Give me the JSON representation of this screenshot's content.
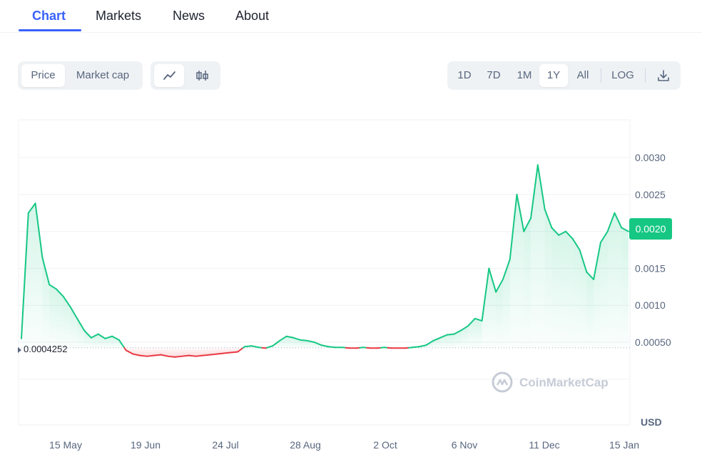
{
  "tabs": [
    {
      "label": "Chart",
      "active": true
    },
    {
      "label": "Markets",
      "active": false
    },
    {
      "label": "News",
      "active": false
    },
    {
      "label": "About",
      "active": false
    }
  ],
  "toolbar": {
    "metric": {
      "options": [
        "Price",
        "Market cap"
      ],
      "selected": "Price"
    },
    "chart_type": {
      "options": [
        "line-chart-icon",
        "candlestick-icon"
      ],
      "selected": "line-chart-icon"
    },
    "ranges": {
      "options": [
        "1D",
        "7D",
        "1M",
        "1Y",
        "All"
      ],
      "selected": "1Y"
    },
    "log_label": "LOG",
    "download_icon": "download-icon"
  },
  "chart": {
    "current_price": "0.0020",
    "reference_price": "0.0004252",
    "currency": "USD",
    "watermark": "CoinMarketCap",
    "colors": {
      "up": "#16c784",
      "down": "#ea3943",
      "grid": "#eff2f5",
      "axis_text": "#58667e"
    }
  },
  "chart_data": {
    "type": "line",
    "x_tick_labels": [
      "15 May",
      "19 Jun",
      "24 Jul",
      "28 Aug",
      "2 Oct",
      "6 Nov",
      "11 Dec",
      "15 Jan"
    ],
    "y_tick_labels": [
      "0.00050",
      "0.0010",
      "0.0015",
      "0.0020",
      "0.0025",
      "0.0030"
    ],
    "y_ticks": [
      0.0005,
      0.001,
      0.0015,
      0.002,
      0.0025,
      0.003
    ],
    "ylim": [
      0.0001,
      0.0031
    ],
    "baseline": 0.0004252,
    "series": [
      {
        "values": [
          0.00055,
          0.00225,
          0.00238,
          0.00165,
          0.00128,
          0.00122,
          0.00112,
          0.00098,
          0.00082,
          0.00066,
          0.00056,
          0.00061,
          0.00055,
          0.00058,
          0.00053,
          0.00039,
          0.00034,
          0.00032,
          0.00031,
          0.00032,
          0.00033,
          0.00031,
          0.0003,
          0.00031,
          0.00032,
          0.00031,
          0.00032,
          0.00033,
          0.00034,
          0.00035,
          0.00036,
          0.00037,
          0.00044,
          0.00045,
          0.00043,
          0.00042,
          0.00045,
          0.00052,
          0.00058,
          0.00056,
          0.00053,
          0.00052,
          0.0005,
          0.00046,
          0.00044,
          0.00043,
          0.00043,
          0.00042,
          0.00042,
          0.00043,
          0.00042,
          0.00042,
          0.00043,
          0.00042,
          0.00042,
          0.00042,
          0.00043,
          0.00044,
          0.00046,
          0.00052,
          0.00056,
          0.0006,
          0.00061,
          0.00066,
          0.00072,
          0.00082,
          0.00079,
          0.0015,
          0.00118,
          0.00135,
          0.00162,
          0.0025,
          0.002,
          0.00218,
          0.0029,
          0.0023,
          0.00205,
          0.00195,
          0.002,
          0.0019,
          0.00175,
          0.00145,
          0.00135,
          0.00185,
          0.002,
          0.00225,
          0.00205,
          0.002
        ]
      }
    ]
  }
}
